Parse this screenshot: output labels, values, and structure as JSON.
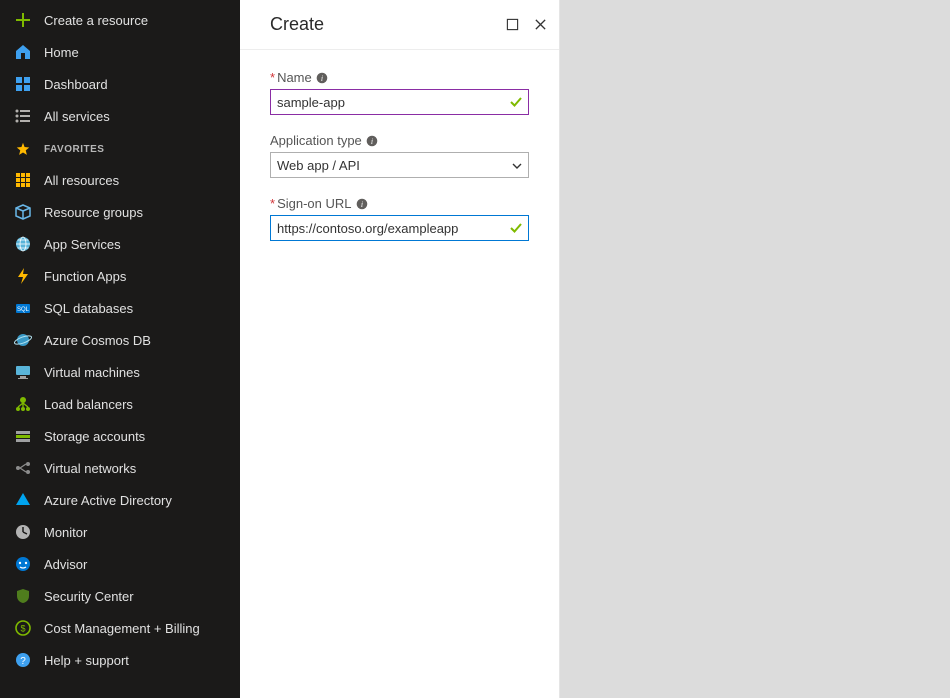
{
  "sidebar": {
    "top": [
      {
        "label": "Create a resource"
      },
      {
        "label": "Home"
      },
      {
        "label": "Dashboard"
      },
      {
        "label": "All services"
      }
    ],
    "favorites_header": "FAVORITES",
    "favorites": [
      {
        "label": "All resources"
      },
      {
        "label": "Resource groups"
      },
      {
        "label": "App Services"
      },
      {
        "label": "Function Apps"
      },
      {
        "label": "SQL databases"
      },
      {
        "label": "Azure Cosmos DB"
      },
      {
        "label": "Virtual machines"
      },
      {
        "label": "Load balancers"
      },
      {
        "label": "Storage accounts"
      },
      {
        "label": "Virtual networks"
      },
      {
        "label": "Azure Active Directory"
      },
      {
        "label": "Monitor"
      },
      {
        "label": "Advisor"
      },
      {
        "label": "Security Center"
      },
      {
        "label": "Cost Management + Billing"
      },
      {
        "label": "Help + support"
      }
    ]
  },
  "panel": {
    "title": "Create",
    "fields": {
      "name": {
        "label": "Name",
        "required": true,
        "value": "sample-app",
        "valid": true
      },
      "app_type": {
        "label": "Application type",
        "required": false,
        "value": "Web app / API"
      },
      "signon_url": {
        "label": "Sign-on URL",
        "required": true,
        "value": "https://contoso.org/exampleapp",
        "valid": true
      }
    }
  },
  "colors": {
    "sidebar_bg": "#1b1a19",
    "accent_green": "#7fba00",
    "accent_blue": "#0078d4",
    "accent_purple": "#8a2da4",
    "star": "#ffb900"
  }
}
